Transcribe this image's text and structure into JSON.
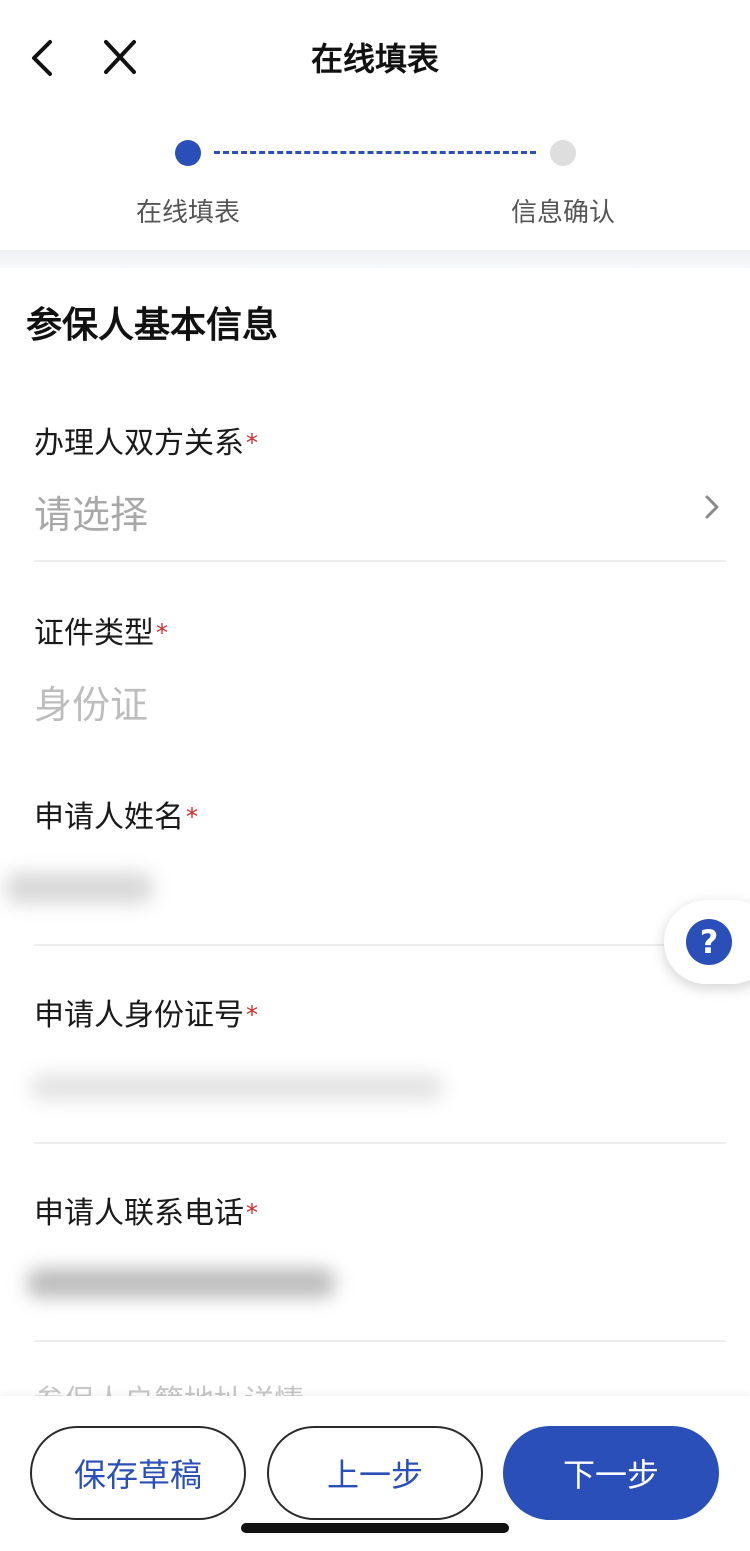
{
  "nav": {
    "title": "在线填表"
  },
  "stepper": {
    "steps": [
      {
        "label": "在线填表",
        "state": "active"
      },
      {
        "label": "信息确认",
        "state": "inactive"
      }
    ]
  },
  "section": {
    "title": "参保人基本信息"
  },
  "fields": {
    "relationship": {
      "label": "办理人双方关系",
      "required_mark": "*",
      "placeholder": "请选择"
    },
    "id_type": {
      "label": "证件类型",
      "required_mark": "*",
      "value": "身份证"
    },
    "applicant_name": {
      "label": "申请人姓名",
      "required_mark": "*"
    },
    "applicant_id_number": {
      "label": "申请人身份证号",
      "required_mark": "*"
    },
    "applicant_phone": {
      "label": "申请人联系电话",
      "required_mark": "*"
    },
    "next_field_partial": {
      "label": "参保人户籍地址详情"
    }
  },
  "help": {
    "icon_text": "?"
  },
  "buttons": {
    "save_draft": "保存草稿",
    "prev": "上一步",
    "next": "下一步"
  },
  "colors": {
    "accent": "#2a4fb8",
    "required": "#d02b2b",
    "placeholder": "#a8a8a8"
  }
}
